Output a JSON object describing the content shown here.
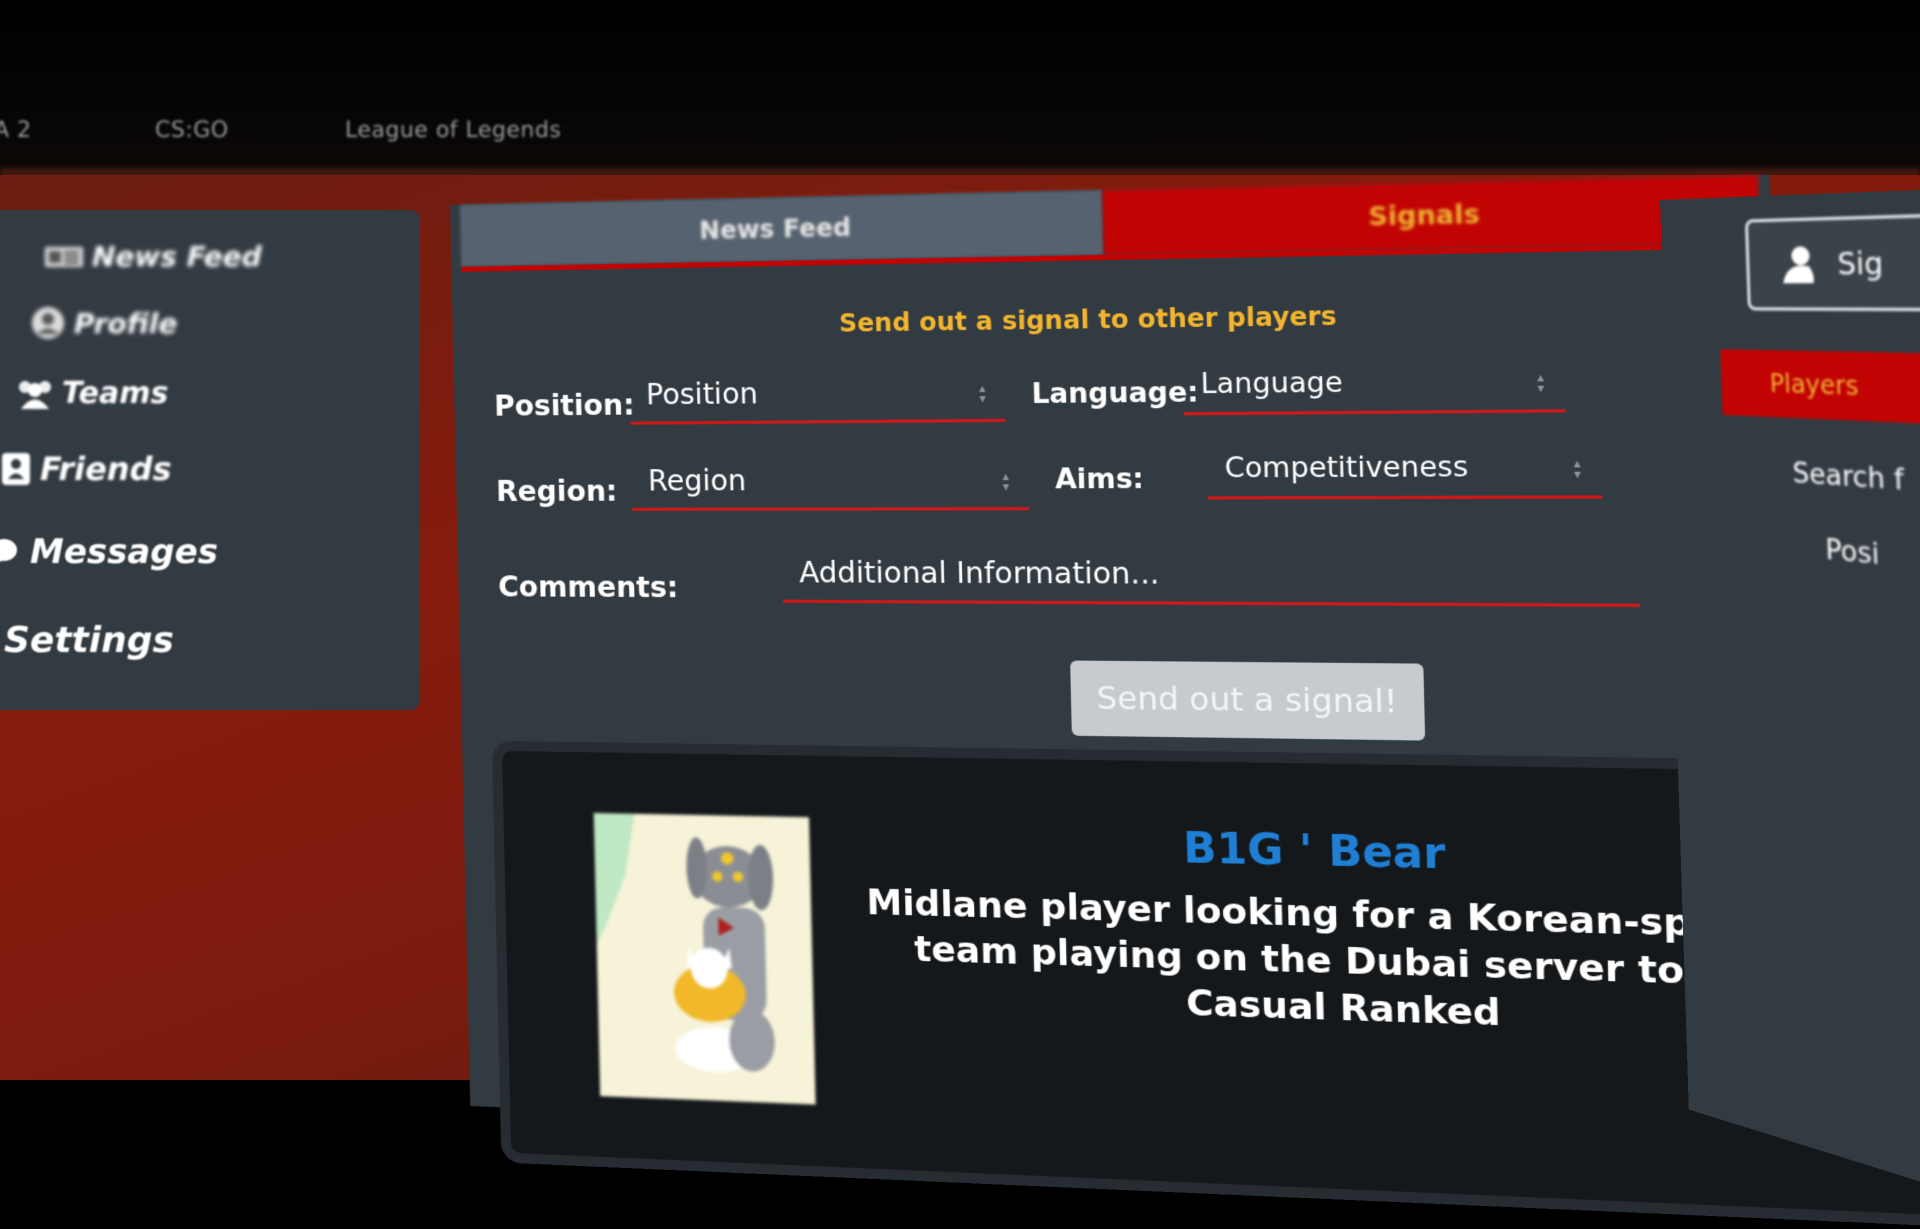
{
  "topnav": {
    "games": [
      "A 2",
      "CS:GO",
      "League of Legends"
    ]
  },
  "sidebar": {
    "items": [
      {
        "label": "News Feed",
        "icon": "newspaper-icon"
      },
      {
        "label": "Profile",
        "icon": "user-icon"
      },
      {
        "label": "Teams",
        "icon": "team-icon"
      },
      {
        "label": "Friends",
        "icon": "contact-icon"
      },
      {
        "label": "Messages",
        "icon": "chat-icon"
      },
      {
        "label": "Settings",
        "icon": ""
      }
    ]
  },
  "main": {
    "tabs": [
      {
        "label": "News Feed",
        "active": false
      },
      {
        "label": "Signals",
        "active": true
      }
    ],
    "signal_title": "Send out a signal to other players",
    "form": {
      "position_label": "Position:",
      "position_value": "Position",
      "language_label": "Language:",
      "language_value": "Language",
      "region_label": "Region:",
      "region_value": "Region",
      "aims_label": "Aims:",
      "aims_value": "Competitiveness",
      "comments_label": "Comments:",
      "comments_placeholder": "Additional Information..."
    },
    "send_button": "Send out a signal!",
    "signal_card": {
      "player_name": "B1G ' Bear",
      "description": "Midlane player looking for a Korean-speaking team playing on the Dubai server to play Casual Ranked"
    }
  },
  "right_panel": {
    "sign_button": "Sig",
    "players_tab": "Players",
    "search_text": "Search f",
    "position_text": "Posi"
  },
  "colors": {
    "accent_red": "#c10303",
    "accent_yellow": "#f3b52e",
    "panel_bg": "#333b42",
    "player_name_blue": "#1f7fd4"
  }
}
